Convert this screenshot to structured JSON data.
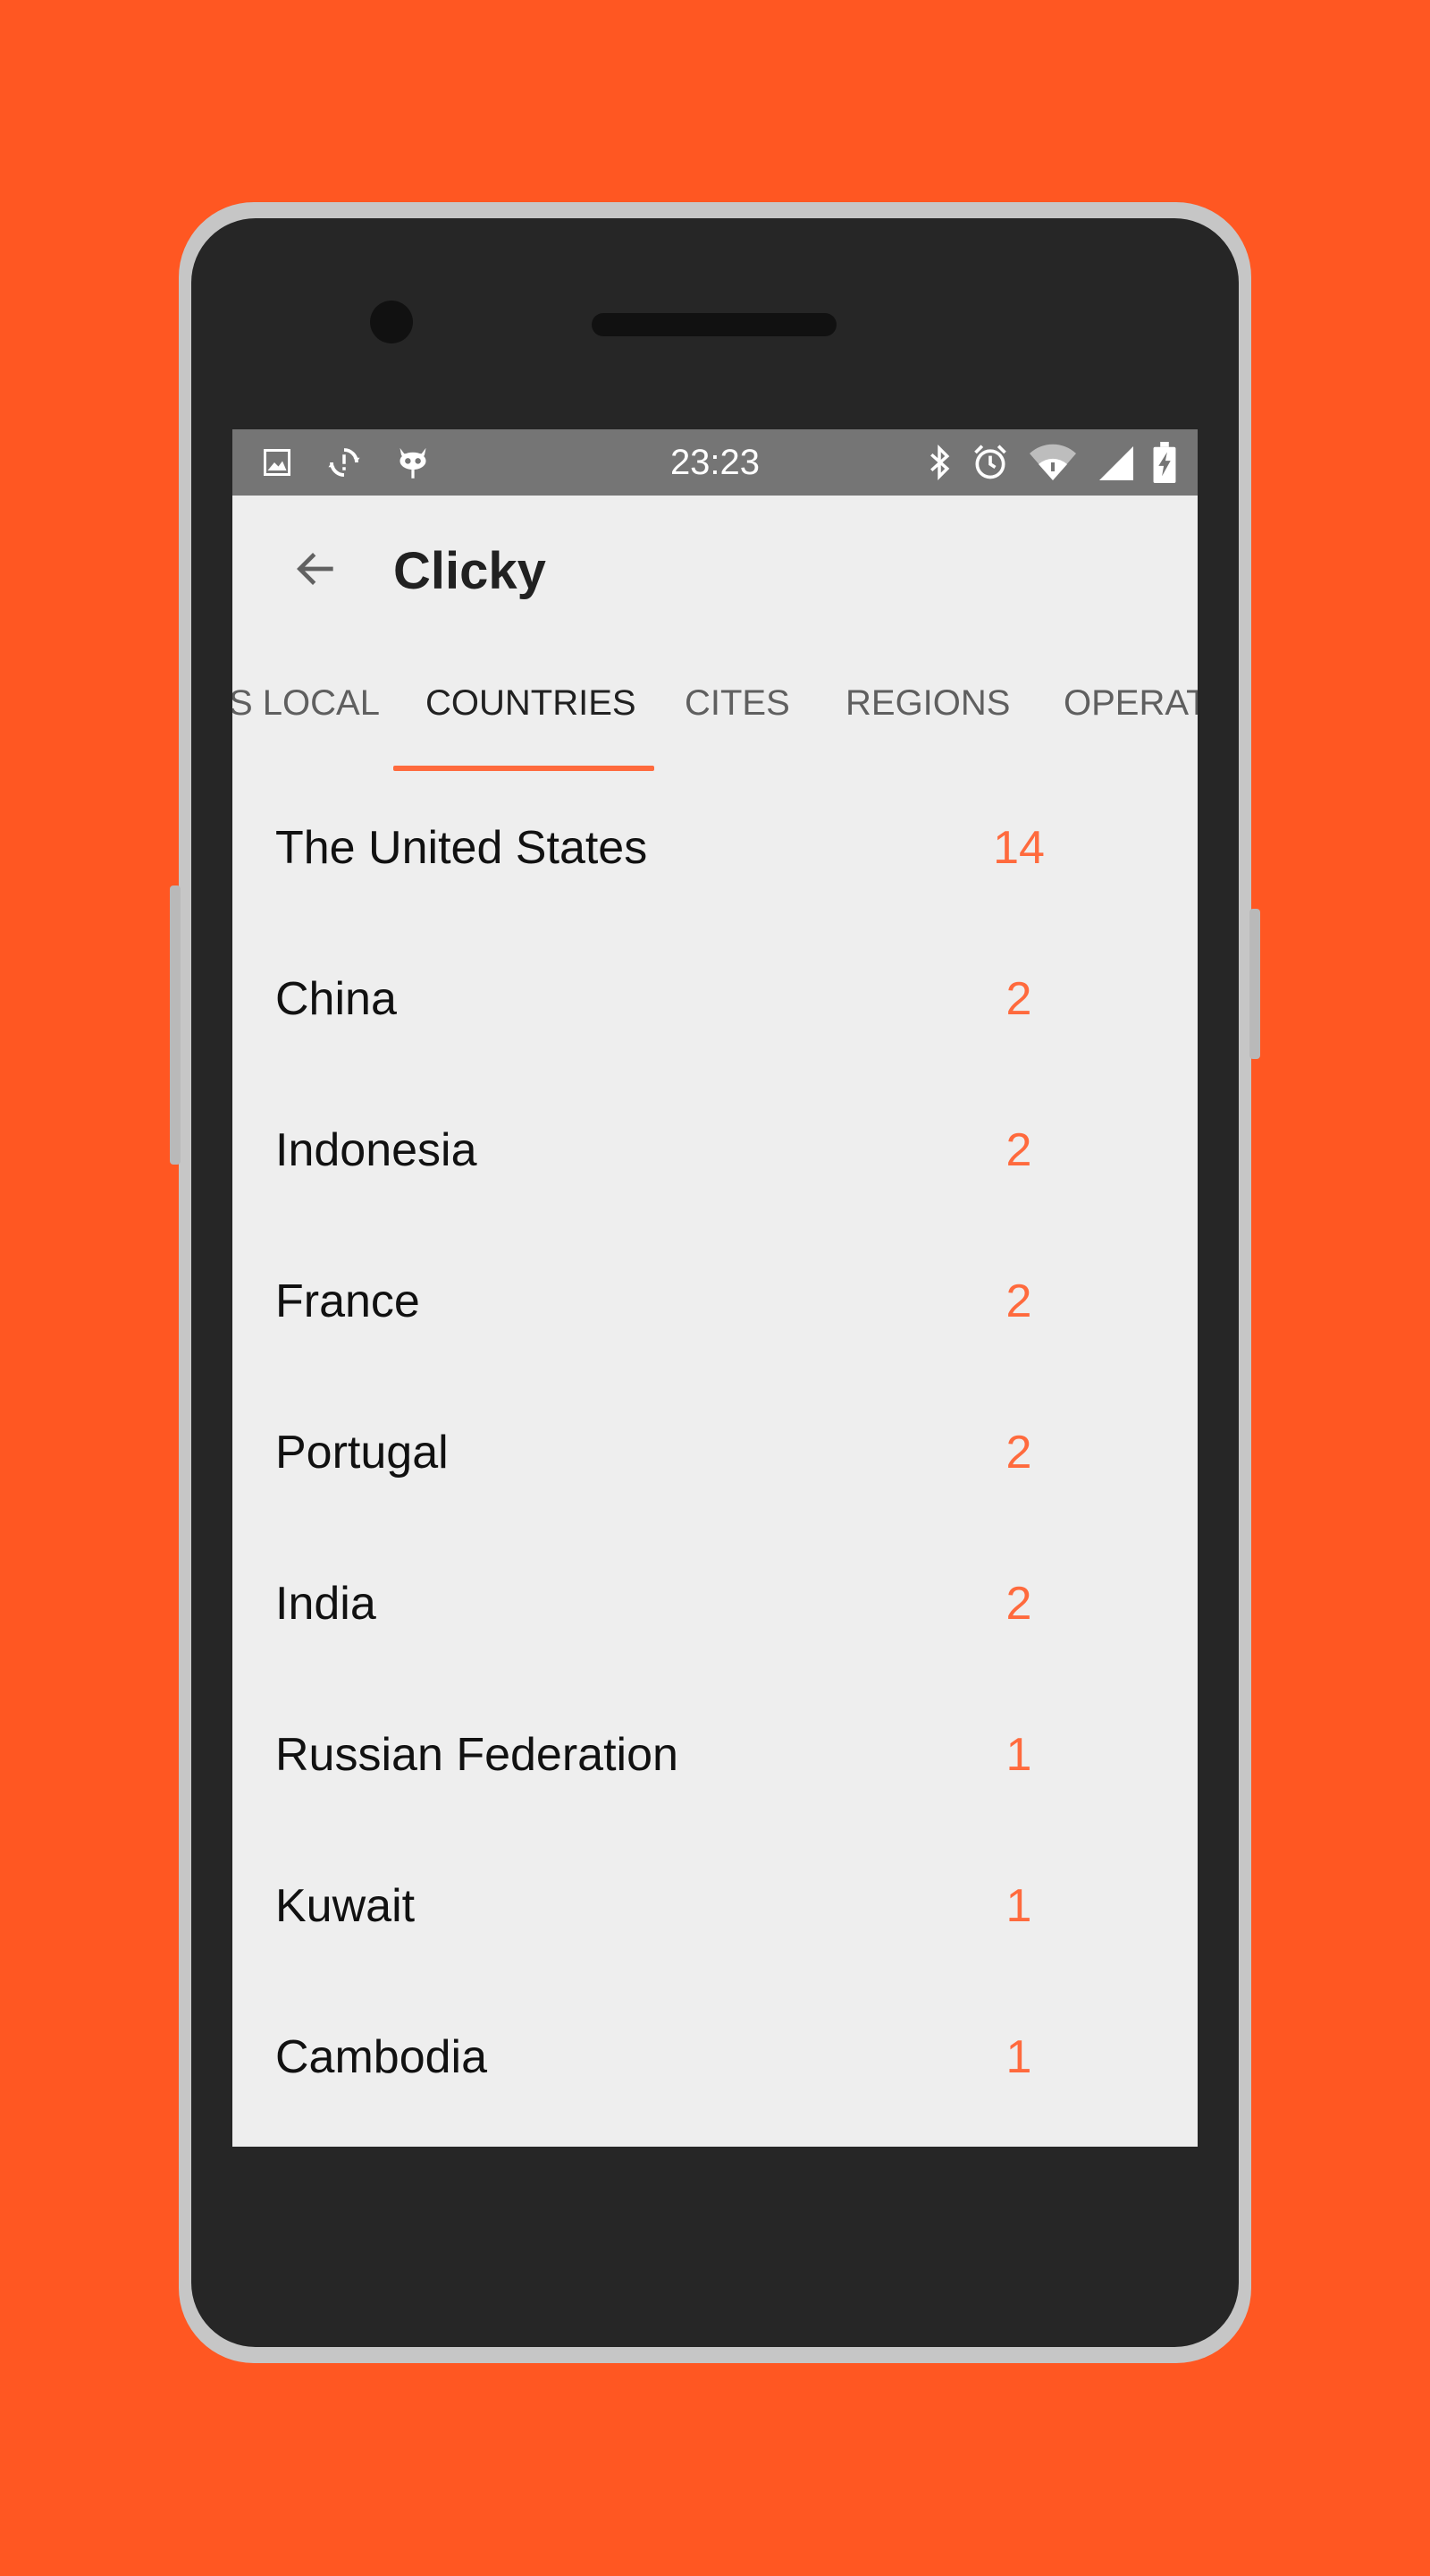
{
  "colors": {
    "background": "#FF5722",
    "accent": "#FF6A3D",
    "status_bar": "#757575",
    "screen": "#eeeeee"
  },
  "status_bar": {
    "time": "23:23",
    "left_icons": [
      "image-icon",
      "sync-icon",
      "cyanogen-icon"
    ],
    "right_icons": [
      "bluetooth-icon",
      "alarm-icon",
      "wifi-icon",
      "signal-icon",
      "battery-charging-icon"
    ]
  },
  "app_bar": {
    "title": "Clicky",
    "back_icon": "arrow-back-icon"
  },
  "tabs": [
    {
      "label": "S LOCAL",
      "active": false
    },
    {
      "label": "COUNTRIES",
      "active": true
    },
    {
      "label": "CITES",
      "active": false
    },
    {
      "label": "REGIONS",
      "active": false
    },
    {
      "label": "OPERAT",
      "active": false
    }
  ],
  "countries": [
    {
      "name": "The United States",
      "count": "14"
    },
    {
      "name": "China",
      "count": "2"
    },
    {
      "name": "Indonesia",
      "count": "2"
    },
    {
      "name": "France",
      "count": "2"
    },
    {
      "name": "Portugal",
      "count": "2"
    },
    {
      "name": "India",
      "count": "2"
    },
    {
      "name": "Russian Federation",
      "count": "1"
    },
    {
      "name": "Kuwait",
      "count": "1"
    },
    {
      "name": "Cambodia",
      "count": "1"
    }
  ]
}
